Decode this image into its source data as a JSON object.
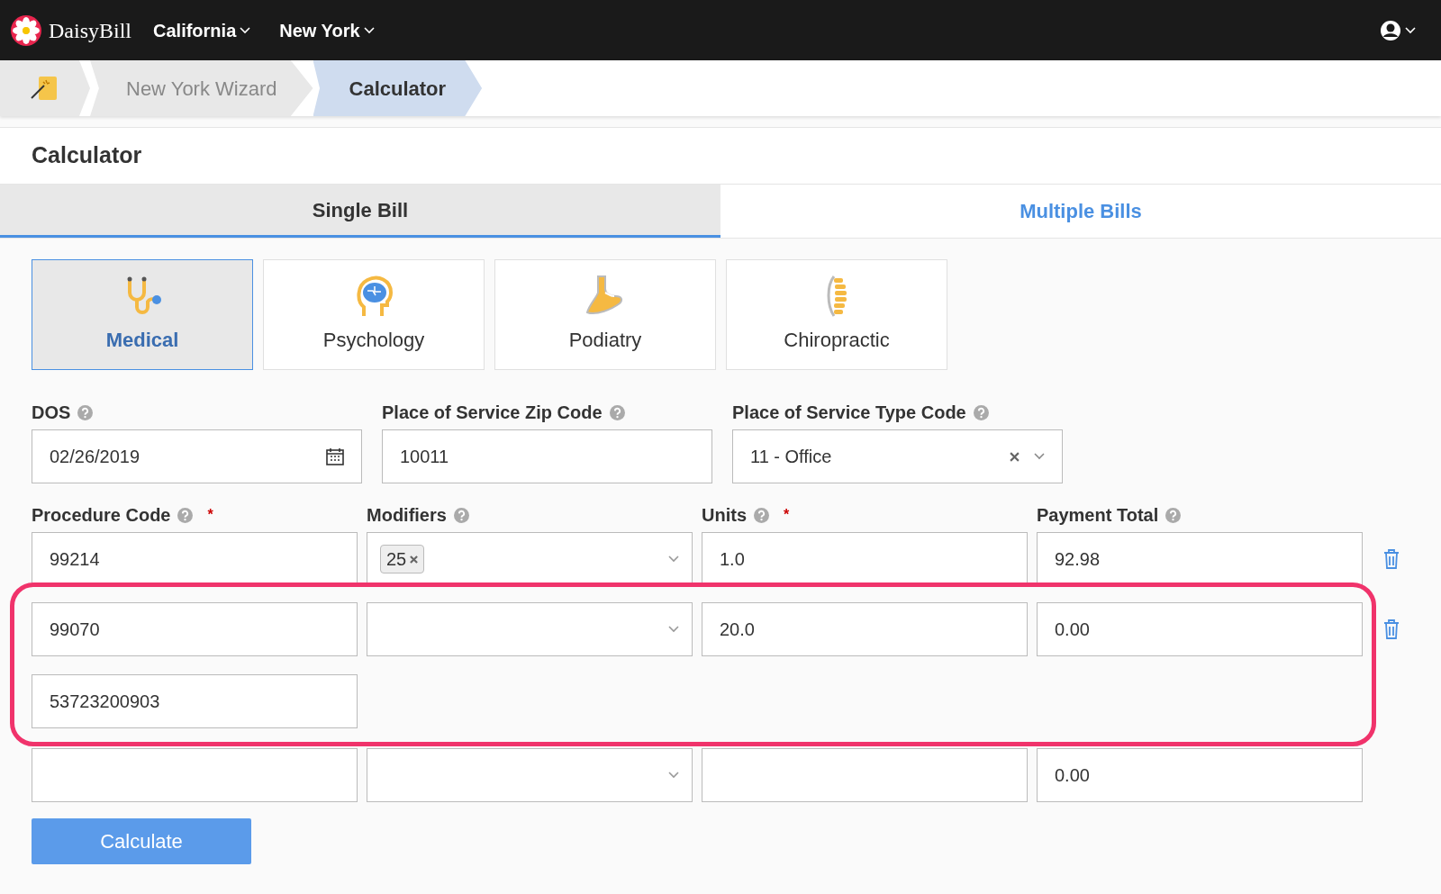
{
  "navbar": {
    "brand": "DaisyBill",
    "menus": [
      {
        "label": "California"
      },
      {
        "label": "New York"
      }
    ]
  },
  "breadcrumb": [
    {
      "label": "New York Wizard",
      "selected": false
    },
    {
      "label": "Calculator",
      "selected": true
    }
  ],
  "heading": "Calculator",
  "tabs": [
    {
      "label": "Single Bill",
      "selected": true
    },
    {
      "label": "Multiple Bills",
      "selected": false
    }
  ],
  "specialties": [
    {
      "kind": "stethoscope",
      "label": "Medical",
      "selected": true
    },
    {
      "kind": "brain",
      "label": "Psychology",
      "selected": false
    },
    {
      "kind": "foot",
      "label": "Podiatry",
      "selected": false
    },
    {
      "kind": "spine",
      "label": "Chiropractic",
      "selected": false
    }
  ],
  "fields": [
    {
      "kind": "date",
      "label": "DOS",
      "value": "02/26/2019"
    },
    {
      "kind": "text",
      "label": "Place of Service Zip Code",
      "value": "10011"
    },
    {
      "kind": "select",
      "label": "Place of Service Type Code",
      "value": "11 - Office"
    }
  ],
  "procedure_columns": [
    {
      "label": "Procedure Code",
      "required_mark": "*"
    },
    {
      "label": "Modifiers"
    },
    {
      "label": "Units",
      "required_mark": "*"
    },
    {
      "label": "Payment Total"
    }
  ],
  "procedure_rows": [
    {
      "code": "99214",
      "modifiers": [
        "25"
      ],
      "units": "1.0",
      "payment": "92.98",
      "deletable": true,
      "highlighted": false
    },
    {
      "code": "99070",
      "modifiers": [],
      "units": "20.0",
      "payment": "0.00",
      "deletable": true,
      "ndc": "53723200903",
      "highlighted": true
    },
    {
      "code": "",
      "modifiers": [],
      "units": "",
      "payment": "0.00",
      "deletable": false,
      "highlighted": false
    }
  ],
  "calculate_button": "Calculate"
}
